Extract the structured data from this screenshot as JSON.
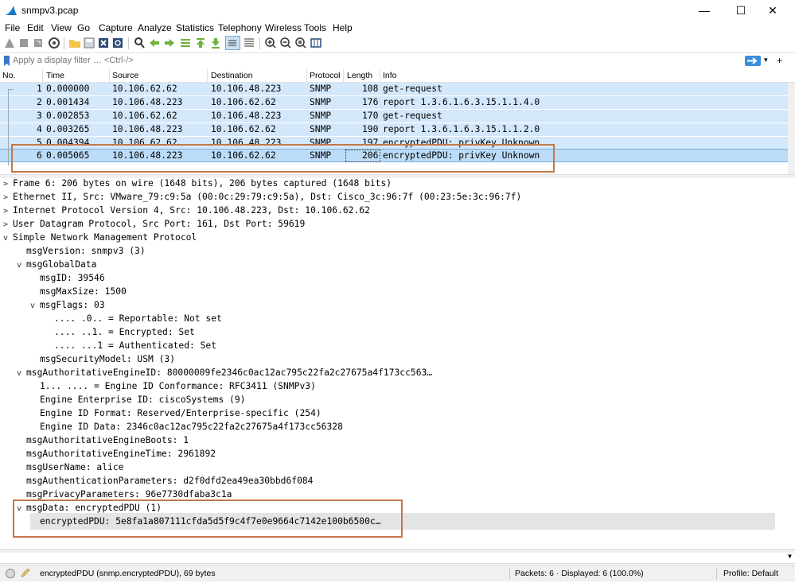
{
  "window": {
    "title": "snmpv3.pcap",
    "minimize": "—",
    "maximize": "☐",
    "close": "✕"
  },
  "menu": [
    "File",
    "Edit",
    "View",
    "Go",
    "Capture",
    "Analyze",
    "Statistics",
    "Telephony",
    "Wireless",
    "Tools",
    "Help"
  ],
  "filter": {
    "placeholder": "Apply a display filter … <Ctrl-/>",
    "plus": "+",
    "dropdown": "▾"
  },
  "packet_list": {
    "columns": [
      "No.",
      "Time",
      "Source",
      "Destination",
      "Protocol",
      "Length",
      "Info"
    ],
    "rows": [
      {
        "no": "1",
        "time": "0.000000",
        "source": "10.106.62.62",
        "destination": "10.106.48.223",
        "protocol": "SNMP",
        "length": "108",
        "info": "get-request"
      },
      {
        "no": "2",
        "time": "0.001434",
        "source": "10.106.48.223",
        "destination": "10.106.62.62",
        "protocol": "SNMP",
        "length": "176",
        "info": "report 1.3.6.1.6.3.15.1.1.4.0"
      },
      {
        "no": "3",
        "time": "0.002853",
        "source": "10.106.62.62",
        "destination": "10.106.48.223",
        "protocol": "SNMP",
        "length": "170",
        "info": "get-request"
      },
      {
        "no": "4",
        "time": "0.003265",
        "source": "10.106.48.223",
        "destination": "10.106.62.62",
        "protocol": "SNMP",
        "length": "190",
        "info": "report 1.3.6.1.6.3.15.1.1.2.0"
      },
      {
        "no": "5",
        "time": "0.004394",
        "source": "10.106.62.62",
        "destination": "10.106.48.223",
        "protocol": "SNMP",
        "length": "197",
        "info": "encryptedPDU: privKey Unknown"
      },
      {
        "no": "6",
        "time": "0.005065",
        "source": "10.106.48.223",
        "destination": "10.106.62.62",
        "protocol": "SNMP",
        "length": "206",
        "info": "encryptedPDU: privKey Unknown"
      }
    ]
  },
  "details": [
    {
      "arrow": ">",
      "text": "Frame 6: 206 bytes on wire (1648 bits), 206 bytes captured (1648 bits)"
    },
    {
      "arrow": ">",
      "text": "Ethernet II, Src: VMware_79:c9:5a (00:0c:29:79:c9:5a), Dst: Cisco_3c:96:7f (00:23:5e:3c:96:7f)"
    },
    {
      "arrow": ">",
      "text": "Internet Protocol Version 4, Src: 10.106.48.223, Dst: 10.106.62.62"
    },
    {
      "arrow": ">",
      "text": "User Datagram Protocol, Src Port: 161, Dst Port: 59619"
    },
    {
      "arrow": "v",
      "text": "Simple Network Management Protocol"
    },
    {
      "arrow": "",
      "text": "msgVersion: snmpv3 (3)"
    },
    {
      "arrow": "v",
      "text": "msgGlobalData"
    },
    {
      "arrow": "",
      "text": "msgID: 39546"
    },
    {
      "arrow": "",
      "text": "msgMaxSize: 1500"
    },
    {
      "arrow": "v",
      "text": "msgFlags: 03"
    },
    {
      "arrow": "",
      "text": ".... .0.. = Reportable: Not set"
    },
    {
      "arrow": "",
      "text": ".... ..1. = Encrypted: Set"
    },
    {
      "arrow": "",
      "text": ".... ...1 = Authenticated: Set"
    },
    {
      "arrow": "",
      "text": "msgSecurityModel: USM (3)"
    },
    {
      "arrow": "v",
      "text": "msgAuthoritativeEngineID: 80000009fe2346c0ac12ac795c22fa2c27675a4f173cc563…"
    },
    {
      "arrow": "",
      "text": "1... .... = Engine ID Conformance: RFC3411 (SNMPv3)"
    },
    {
      "arrow": "",
      "text": "Engine Enterprise ID: ciscoSystems (9)"
    },
    {
      "arrow": "",
      "text": "Engine ID Format: Reserved/Enterprise-specific (254)"
    },
    {
      "arrow": "",
      "text": "Engine ID Data: 2346c0ac12ac795c22fa2c27675a4f173cc56328"
    },
    {
      "arrow": "",
      "text": "msgAuthoritativeEngineBoots: 1"
    },
    {
      "arrow": "",
      "text": "msgAuthoritativeEngineTime: 2961892"
    },
    {
      "arrow": "",
      "text": "msgUserName: alice"
    },
    {
      "arrow": "",
      "text": "msgAuthenticationParameters: d2f0dfd2ea49ea30bbd6f084"
    },
    {
      "arrow": "",
      "text": "msgPrivacyParameters: 96e7730dfaba3c1a"
    },
    {
      "arrow": "v",
      "text": "msgData: encryptedPDU (1)"
    },
    {
      "arrow": "",
      "text": "encryptedPDU: 5e8fa1a807111cfda5d5f9c4f7e0e9664c7142e100b6500c…"
    }
  ],
  "status": {
    "field": "encryptedPDU (snmp.encryptedPDU), 69 bytes",
    "packets": "Packets: 6 · Displayed: 6 (100.0%)",
    "profile": "Profile: Default"
  },
  "colors": {
    "row_bg": "#d4e8fb",
    "selected_row_bg": "#bcdcf7",
    "annotation_box": "#c0784a"
  }
}
